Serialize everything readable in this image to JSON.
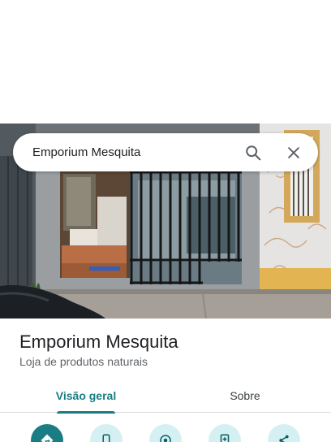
{
  "search": {
    "query": "Emporium Mesquita"
  },
  "place": {
    "name": "Emporium Mesquita",
    "category": "Loja de produtos naturais"
  },
  "tabs": [
    {
      "label": "Visão geral",
      "selected": true
    },
    {
      "label": "Sobre",
      "selected": false
    }
  ],
  "actions": [
    {
      "icon": "directions-icon",
      "primary": true
    },
    {
      "icon": "phone-icon",
      "primary": false
    },
    {
      "icon": "location-icon",
      "primary": false
    },
    {
      "icon": "save-icon",
      "primary": false
    },
    {
      "icon": "share-icon",
      "primary": false
    }
  ],
  "colors": {
    "accent": "#1a7d83",
    "action_bg": "#d5f0f3"
  }
}
